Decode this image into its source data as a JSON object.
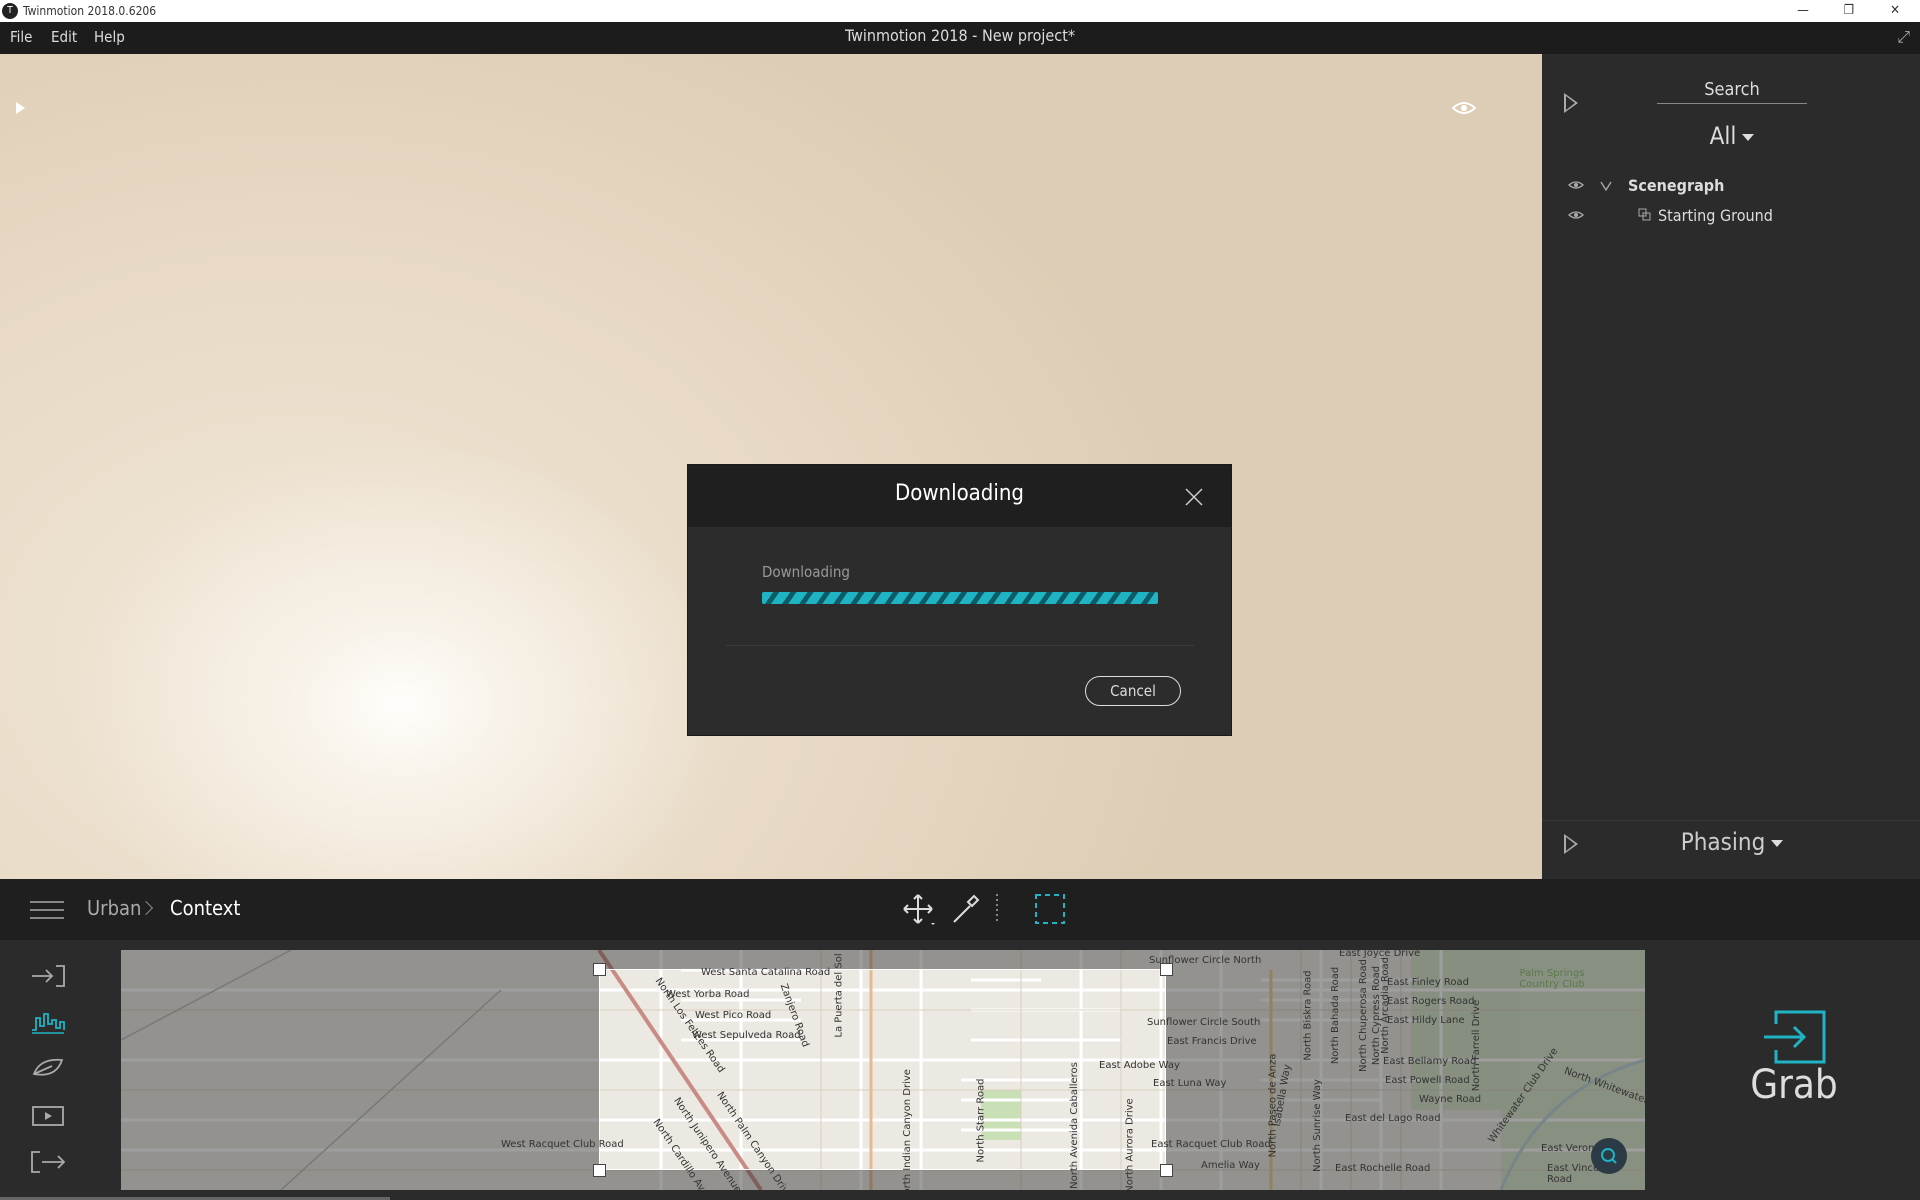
{
  "window": {
    "title": "Twinmotion 2018.0.6206",
    "app_icon_label": "T"
  },
  "menubar": {
    "items": [
      "File",
      "Edit",
      "Help"
    ],
    "project_title": "Twinmotion 2018 - New project*"
  },
  "right_panel": {
    "search_label": "Search",
    "filter": "All",
    "tree": [
      {
        "label": "Scenegraph",
        "expanded": true
      },
      {
        "label": "Starting Ground"
      }
    ],
    "phasing_label": "Phasing"
  },
  "dialog": {
    "title": "Downloading",
    "status_label": "Downloading",
    "cancel_label": "Cancel"
  },
  "bottombar": {
    "breadcrumb": [
      "Urban",
      "Context"
    ]
  },
  "map_labels": [
    "West Santa Catalina Road",
    "West Yorba Road",
    "West Pico Road",
    "West Sepulveda Road",
    "North Los Felices Road",
    "Zanjero Road",
    "La Puerta del Sol",
    "North Palm Canyon Drive",
    "North Junipero Avenue",
    "North Cardillo Avenue",
    "North Indian Canyon Drive",
    "North Starr Road",
    "North Avenida Caballeros",
    "North Aurora Drive",
    "East Adobe Way",
    "East Luna Way",
    "Sunflower Circle North",
    "Sunflower Circle South",
    "East Francis Drive",
    "East Racquet Club Road",
    "West Racquet Club Road",
    "North Paseo de Anza",
    "Isabella Way",
    "North Sunrise Way",
    "North Bahada Road",
    "North Chuperosa Road",
    "North Cypress Road",
    "North Biskra Road",
    "East Finley Road",
    "East Rogers Road",
    "East Hildy Lane",
    "East Bellamy Road",
    "East Powell Road",
    "Wayne Road",
    "East del Lago Road",
    "East Rochelle Road",
    "Amelia Way",
    "East Verona",
    "East Vincentia Road",
    "North Whitewater Club",
    "Palm Springs Country Club",
    "North Farrell Drive",
    "Whitewater Club Drive",
    "North Arcadia Road",
    "East Joyce Drive"
  ],
  "grab_label": "Grab",
  "colors": {
    "accent": "#1fb3c4",
    "panel": "#2b2b2b",
    "dark": "#1f1f1f"
  }
}
